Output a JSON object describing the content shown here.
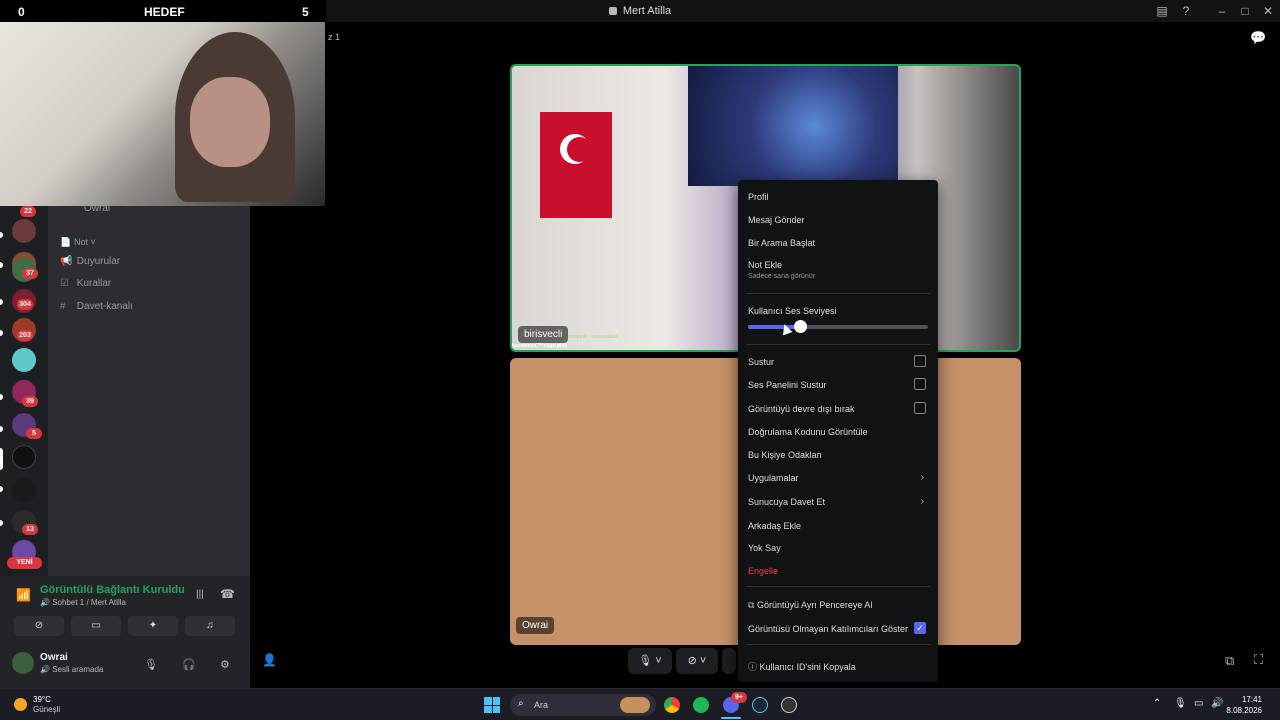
{
  "window": {
    "title": "Mert Atilla"
  },
  "overlay": {
    "left_score": "0",
    "label": "HEDEF",
    "right_score": "5",
    "partial_text": "z 1"
  },
  "servers": {
    "badges": [
      "22",
      "37",
      "304",
      "203",
      "39",
      "5",
      "13"
    ],
    "new_label": "YENİ"
  },
  "channels": {
    "top_user": "Owrai",
    "category": "Not",
    "items": [
      {
        "label": "Duyurular"
      },
      {
        "label": "Kurallar"
      },
      {
        "label": "Davet-kanalı"
      }
    ]
  },
  "voice": {
    "status": "Görüntülü Bağlantı Kuruldu",
    "channel": "Sohbet 1 / Mert Atilla",
    "user": {
      "name": "Owrai",
      "status": "Sesli aramada"
    }
  },
  "stage": {
    "tile1": {
      "name": "birisvecli",
      "chat_line_1": "amipink : ankaradaki",
      "chat_line_2": "kuzenimin ***cuğu pink"
    },
    "tile2": {
      "name": "Owrai"
    }
  },
  "context_menu": {
    "items": {
      "profile": "Profil",
      "message": "Mesaj Gönder",
      "call": "Bir Arama Başlat",
      "note": "Not Ekle",
      "note_hint": "Sadece sana görünür",
      "volume": "Kullanıcı Ses Seviyesi",
      "mute": "Sustur",
      "mute_soundboard": "Ses Panelini Sustur",
      "disable_video": "Görüntüyü devre dışı bırak",
      "verify": "Doğrulama Kodunu Görüntüle",
      "focus": "Bu Kişiye Odaklan",
      "apps": "Uygulamalar",
      "invite": "Sunucuya Davet Et",
      "add_friend": "Arkadaş Ekle",
      "ignore": "Yok Say",
      "block": "Engelle",
      "popout": "Görüntüyü Ayrı Pencereye Al",
      "show_non_video": "Görüntüsü Olmayan Katılımcıları Göster",
      "copy_id": "Kullanıcı ID'sini Kopyala"
    },
    "volume_level_percent": 29,
    "show_non_video_checked": true
  },
  "taskbar": {
    "weather_temp": "39°C",
    "weather_desc": "Güneşli",
    "search_placeholder": "Ara",
    "time": "17:41",
    "date": "8.08.2026",
    "discord_badge": "9+"
  }
}
